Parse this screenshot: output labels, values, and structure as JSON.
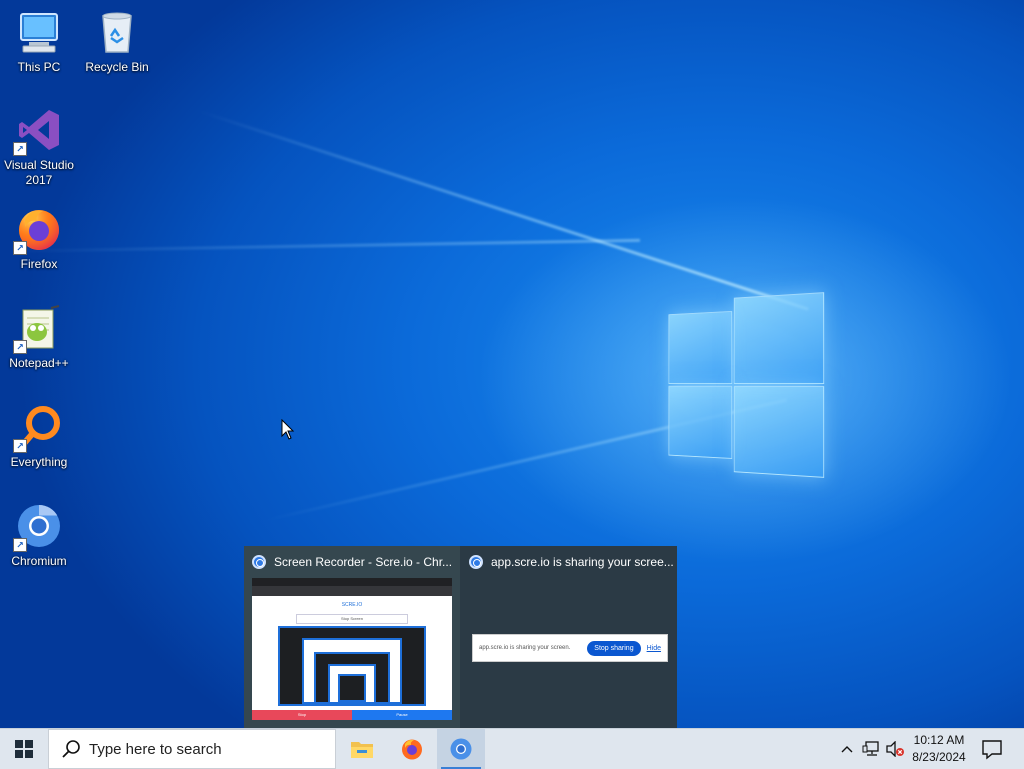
{
  "desktop": {
    "icons": [
      {
        "label": "This PC",
        "icon": "computer-icon"
      },
      {
        "label": "Recycle Bin",
        "icon": "recycle-bin-icon"
      },
      {
        "label": "Visual Studio 2017",
        "icon": "visual-studio-icon"
      },
      {
        "label": "Firefox",
        "icon": "firefox-icon"
      },
      {
        "label": "Notepad++",
        "icon": "notepadpp-icon"
      },
      {
        "label": "Everything",
        "icon": "everything-search-icon"
      },
      {
        "label": "Chromium",
        "icon": "chromium-icon"
      }
    ]
  },
  "preview": {
    "windows": [
      {
        "title": "Screen Recorder - Scre.io - Chr...",
        "icon": "chromium-icon"
      },
      {
        "title": "app.scre.io is sharing your scree...",
        "icon": "chromium-icon"
      }
    ],
    "thumb1": {
      "brand": "SCRE.IO",
      "screen_label": "Stop Screen",
      "left_btn": "Stop",
      "right_btn": "Pause"
    },
    "share_bar": {
      "text": "app.scre.io is sharing your screen.",
      "stop_label": "Stop sharing",
      "hide_label": "Hide"
    }
  },
  "taskbar": {
    "search_placeholder": "Type here to search",
    "apps": [
      {
        "name": "File Explorer",
        "icon": "folder-icon"
      },
      {
        "name": "Firefox",
        "icon": "firefox-icon"
      },
      {
        "name": "Chromium",
        "icon": "chromium-icon"
      }
    ],
    "time": "10:12 AM",
    "date": "8/23/2024",
    "accent": "#3a7fd5"
  }
}
